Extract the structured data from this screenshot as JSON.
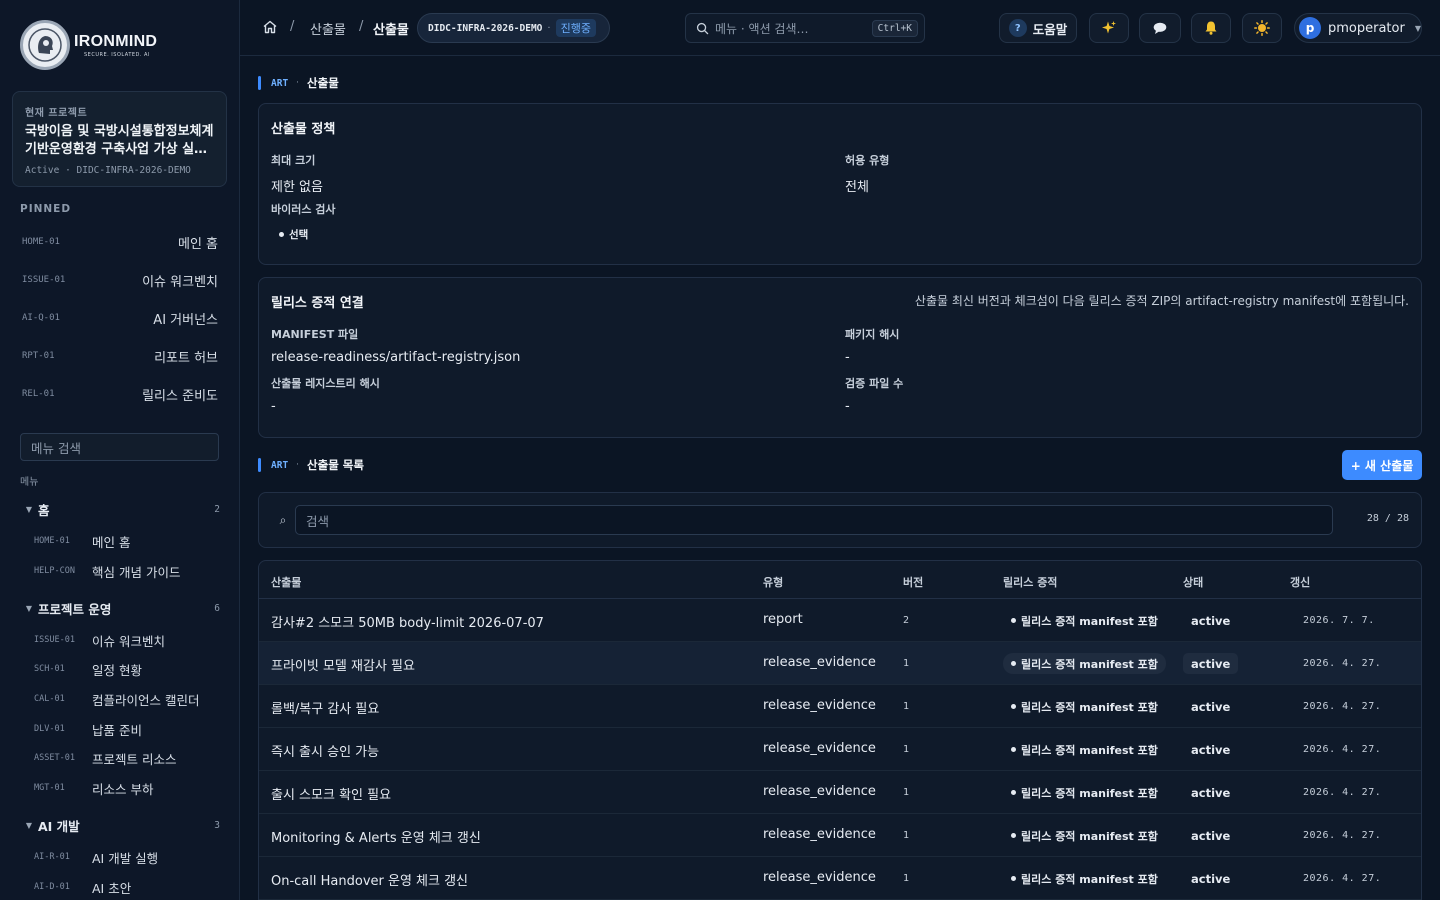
{
  "brand": {
    "name": "IRONMIND",
    "tagline": "SECURE. ISOLATED. AI"
  },
  "project": {
    "label": "현재 프로젝트",
    "name": "국방이음 및 국방시설통합정보체계 기반운영환경 구축사업 가상 실…",
    "status": "Active",
    "code": "DIDC-INFRA-2026-DEMO"
  },
  "pinned": {
    "title": "PINNED",
    "items": [
      {
        "code": "HOME-01",
        "label": "메인 홈"
      },
      {
        "code": "ISSUE-01",
        "label": "이슈 워크벤치"
      },
      {
        "code": "AI-Q-01",
        "label": "AI 거버넌스"
      },
      {
        "code": "RPT-01",
        "label": "리포트 허브"
      },
      {
        "code": "REL-01",
        "label": "릴리스 준비도"
      }
    ]
  },
  "menu": {
    "search_placeholder": "메뉴 검색",
    "caption": "메뉴",
    "groups": [
      {
        "label": "홈",
        "count": "2",
        "items": [
          {
            "code": "HOME-01",
            "label": "메인 홈"
          },
          {
            "code": "HELP-CON",
            "label": "핵심 개념 가이드"
          }
        ]
      },
      {
        "label": "프로젝트 운영",
        "count": "6",
        "items": [
          {
            "code": "ISSUE-01",
            "label": "이슈 워크벤치"
          },
          {
            "code": "SCH-01",
            "label": "일정 현황"
          },
          {
            "code": "CAL-01",
            "label": "컴플라이언스 캘린더"
          },
          {
            "code": "DLV-01",
            "label": "납품 준비"
          },
          {
            "code": "ASSET-01",
            "label": "프로젝트 리소스"
          },
          {
            "code": "MGT-01",
            "label": "리소스 부하"
          }
        ]
      },
      {
        "label": "AI 개발",
        "count": "3",
        "items": [
          {
            "code": "AI-R-01",
            "label": "AI 개발 실행"
          },
          {
            "code": "AI-D-01",
            "label": "AI 초안"
          }
        ]
      }
    ]
  },
  "topbar": {
    "breadcrumb": [
      "산출물",
      "산출물"
    ],
    "project_code": "DIDC-INFRA-2026-DEMO",
    "project_sep": "·",
    "project_status": "진행중",
    "search_placeholder": "메뉴 · 액션 검색…",
    "search_shortcut": "Ctrl+K",
    "help_label": "도움말",
    "help_glyph": "?",
    "user_initial": "p",
    "user_name": "pmoperator",
    "icons": [
      "home-icon",
      "search-icon",
      "sparkle-icon",
      "chat-icon",
      "bell-icon",
      "theme-sun-icon",
      "chevron-down-icon"
    ]
  },
  "section_main": {
    "code": "ART",
    "sep": "·",
    "title": "산출물"
  },
  "policy": {
    "title": "산출물 정책",
    "max_size_label": "최대 크기",
    "max_size_value": "제한 없음",
    "allowed_type_label": "허용 유형",
    "allowed_type_value": "전체",
    "binary_check_label": "바이러스 검사",
    "binary_check_value": "선택"
  },
  "release": {
    "title": "릴리스 증적 연결",
    "note": "산출물 최신 버전과 체크섬이 다음 릴리스 증적 ZIP의 artifact-registry manifest에 포함됩니다.",
    "manifest_label": "MANIFEST 파일",
    "manifest_value": "release-readiness/artifact-registry.json",
    "package_hash_label": "패키지 해시",
    "package_hash_value": "-",
    "registry_hash_label": "산출물 레지스트리 해시",
    "registry_hash_value": "-",
    "verify_count_label": "검증 파일 수",
    "verify_count_value": "-"
  },
  "section_list": {
    "code": "ART",
    "sep": "·",
    "title": "산출물 목록"
  },
  "new_button": "+ 새 산출물",
  "list": {
    "search_glyph": "⌕",
    "search_placeholder": "검색",
    "count": "28 / 28",
    "columns": [
      "산출물",
      "유형",
      "버전",
      "릴리스 증적",
      "상태",
      "갱신"
    ],
    "rows": [
      {
        "name": "감사#2 스모크 50MB body-limit 2026-07-07",
        "type": "report",
        "version": "2",
        "evidence": "릴리스 증적 manifest 포함",
        "state": "active",
        "updated": "2026. 7. 7."
      },
      {
        "name": "프라이빗 모델 재감사 필요",
        "type": "release_evidence",
        "version": "1",
        "evidence": "릴리스 증적 manifest 포함",
        "state": "active",
        "updated": "2026. 4. 27."
      },
      {
        "name": "롤백/복구 감사 필요",
        "type": "release_evidence",
        "version": "1",
        "evidence": "릴리스 증적 manifest 포함",
        "state": "active",
        "updated": "2026. 4. 27."
      },
      {
        "name": "즉시 출시 승인 가능",
        "type": "release_evidence",
        "version": "1",
        "evidence": "릴리스 증적 manifest 포함",
        "state": "active",
        "updated": "2026. 4. 27."
      },
      {
        "name": "출시 스모크 확인 필요",
        "type": "release_evidence",
        "version": "1",
        "evidence": "릴리스 증적 manifest 포함",
        "state": "active",
        "updated": "2026. 4. 27."
      },
      {
        "name": "Monitoring & Alerts 운영 체크 갱신",
        "type": "release_evidence",
        "version": "1",
        "evidence": "릴리스 증적 manifest 포함",
        "state": "active",
        "updated": "2026. 4. 27."
      },
      {
        "name": "On-call Handover 운영 체크 갱신",
        "type": "release_evidence",
        "version": "1",
        "evidence": "릴리스 증적 manifest 포함",
        "state": "active",
        "updated": "2026. 4. 27."
      }
    ]
  },
  "colors": {
    "accent": "#3d8bff",
    "background": "#0b1524",
    "panel": "#0f1a2a",
    "status_blue": "#6fb0ff"
  }
}
